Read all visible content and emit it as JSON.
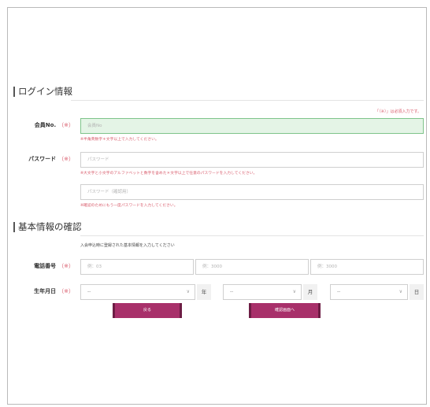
{
  "login_section": {
    "title": "ログイン情報",
    "required_note": "「（※）」は必須入力です。"
  },
  "member_no": {
    "label": "会員No.",
    "required_mark": "（※）",
    "placeholder": "会員No",
    "hint": "※半角英数字＊文字以上で入力してください。"
  },
  "password": {
    "label": "パスワード",
    "required_mark": "（※）",
    "placeholder": "パスワード",
    "hint": "※大文字と小文字のアルファベットと数字を含めた＊文字以上で任意のパスワードを入力してください。",
    "confirm_placeholder": "パスワード（確認用）",
    "confirm_hint": "※確認のためにもう一度パスワードを入力してください。"
  },
  "basic_section": {
    "title": "基本情報の確認",
    "description": "入会申込時に登録された基本情報を入力してください"
  },
  "phone": {
    "label": "電話番号",
    "required_mark": "（※）",
    "placeholders": [
      "例：03",
      "例：3000",
      "例：3000"
    ]
  },
  "birthdate": {
    "label": "生年月日",
    "required_mark": "（※）",
    "selects": [
      {
        "value": "--",
        "unit": "年"
      },
      {
        "value": "--",
        "unit": "月"
      },
      {
        "value": "--",
        "unit": "日"
      }
    ]
  },
  "buttons": {
    "back": "戻る",
    "confirm": "確認画面へ"
  },
  "colors": {
    "accent": "#a8306a",
    "required": "#d85a6a",
    "focus_bg": "#e4f4e6"
  }
}
